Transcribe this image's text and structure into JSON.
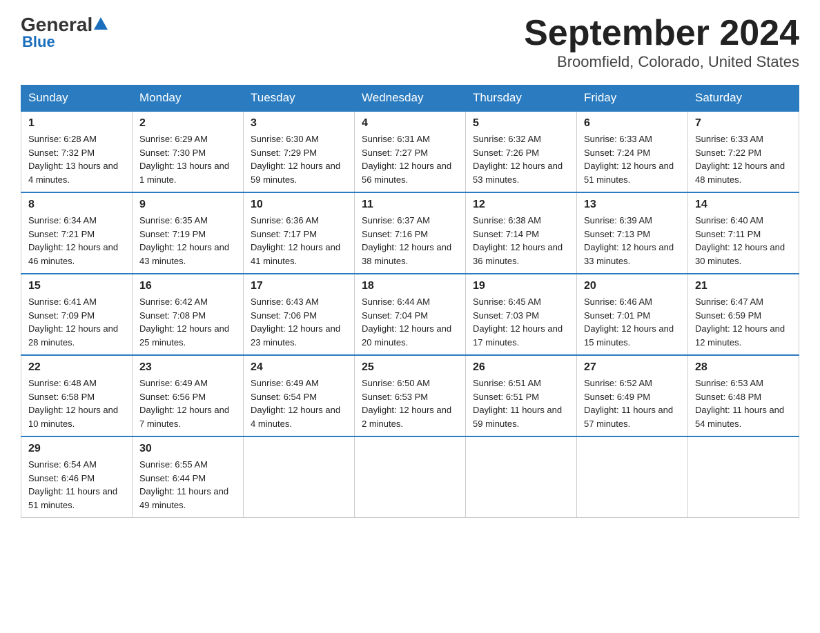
{
  "logo": {
    "general": "General",
    "triangle": "▲",
    "blue": "Blue"
  },
  "title": "September 2024",
  "subtitle": "Broomfield, Colorado, United States",
  "days_of_week": [
    "Sunday",
    "Monday",
    "Tuesday",
    "Wednesday",
    "Thursday",
    "Friday",
    "Saturday"
  ],
  "weeks": [
    [
      {
        "day": "1",
        "sunrise": "6:28 AM",
        "sunset": "7:32 PM",
        "daylight": "13 hours and 4 minutes."
      },
      {
        "day": "2",
        "sunrise": "6:29 AM",
        "sunset": "7:30 PM",
        "daylight": "13 hours and 1 minute."
      },
      {
        "day": "3",
        "sunrise": "6:30 AM",
        "sunset": "7:29 PM",
        "daylight": "12 hours and 59 minutes."
      },
      {
        "day": "4",
        "sunrise": "6:31 AM",
        "sunset": "7:27 PM",
        "daylight": "12 hours and 56 minutes."
      },
      {
        "day": "5",
        "sunrise": "6:32 AM",
        "sunset": "7:26 PM",
        "daylight": "12 hours and 53 minutes."
      },
      {
        "day": "6",
        "sunrise": "6:33 AM",
        "sunset": "7:24 PM",
        "daylight": "12 hours and 51 minutes."
      },
      {
        "day": "7",
        "sunrise": "6:33 AM",
        "sunset": "7:22 PM",
        "daylight": "12 hours and 48 minutes."
      }
    ],
    [
      {
        "day": "8",
        "sunrise": "6:34 AM",
        "sunset": "7:21 PM",
        "daylight": "12 hours and 46 minutes."
      },
      {
        "day": "9",
        "sunrise": "6:35 AM",
        "sunset": "7:19 PM",
        "daylight": "12 hours and 43 minutes."
      },
      {
        "day": "10",
        "sunrise": "6:36 AM",
        "sunset": "7:17 PM",
        "daylight": "12 hours and 41 minutes."
      },
      {
        "day": "11",
        "sunrise": "6:37 AM",
        "sunset": "7:16 PM",
        "daylight": "12 hours and 38 minutes."
      },
      {
        "day": "12",
        "sunrise": "6:38 AM",
        "sunset": "7:14 PM",
        "daylight": "12 hours and 36 minutes."
      },
      {
        "day": "13",
        "sunrise": "6:39 AM",
        "sunset": "7:13 PM",
        "daylight": "12 hours and 33 minutes."
      },
      {
        "day": "14",
        "sunrise": "6:40 AM",
        "sunset": "7:11 PM",
        "daylight": "12 hours and 30 minutes."
      }
    ],
    [
      {
        "day": "15",
        "sunrise": "6:41 AM",
        "sunset": "7:09 PM",
        "daylight": "12 hours and 28 minutes."
      },
      {
        "day": "16",
        "sunrise": "6:42 AM",
        "sunset": "7:08 PM",
        "daylight": "12 hours and 25 minutes."
      },
      {
        "day": "17",
        "sunrise": "6:43 AM",
        "sunset": "7:06 PM",
        "daylight": "12 hours and 23 minutes."
      },
      {
        "day": "18",
        "sunrise": "6:44 AM",
        "sunset": "7:04 PM",
        "daylight": "12 hours and 20 minutes."
      },
      {
        "day": "19",
        "sunrise": "6:45 AM",
        "sunset": "7:03 PM",
        "daylight": "12 hours and 17 minutes."
      },
      {
        "day": "20",
        "sunrise": "6:46 AM",
        "sunset": "7:01 PM",
        "daylight": "12 hours and 15 minutes."
      },
      {
        "day": "21",
        "sunrise": "6:47 AM",
        "sunset": "6:59 PM",
        "daylight": "12 hours and 12 minutes."
      }
    ],
    [
      {
        "day": "22",
        "sunrise": "6:48 AM",
        "sunset": "6:58 PM",
        "daylight": "12 hours and 10 minutes."
      },
      {
        "day": "23",
        "sunrise": "6:49 AM",
        "sunset": "6:56 PM",
        "daylight": "12 hours and 7 minutes."
      },
      {
        "day": "24",
        "sunrise": "6:49 AM",
        "sunset": "6:54 PM",
        "daylight": "12 hours and 4 minutes."
      },
      {
        "day": "25",
        "sunrise": "6:50 AM",
        "sunset": "6:53 PM",
        "daylight": "12 hours and 2 minutes."
      },
      {
        "day": "26",
        "sunrise": "6:51 AM",
        "sunset": "6:51 PM",
        "daylight": "11 hours and 59 minutes."
      },
      {
        "day": "27",
        "sunrise": "6:52 AM",
        "sunset": "6:49 PM",
        "daylight": "11 hours and 57 minutes."
      },
      {
        "day": "28",
        "sunrise": "6:53 AM",
        "sunset": "6:48 PM",
        "daylight": "11 hours and 54 minutes."
      }
    ],
    [
      {
        "day": "29",
        "sunrise": "6:54 AM",
        "sunset": "6:46 PM",
        "daylight": "11 hours and 51 minutes."
      },
      {
        "day": "30",
        "sunrise": "6:55 AM",
        "sunset": "6:44 PM",
        "daylight": "11 hours and 49 minutes."
      },
      null,
      null,
      null,
      null,
      null
    ]
  ],
  "labels": {
    "sunrise": "Sunrise: ",
    "sunset": "Sunset: ",
    "daylight": "Daylight: "
  }
}
